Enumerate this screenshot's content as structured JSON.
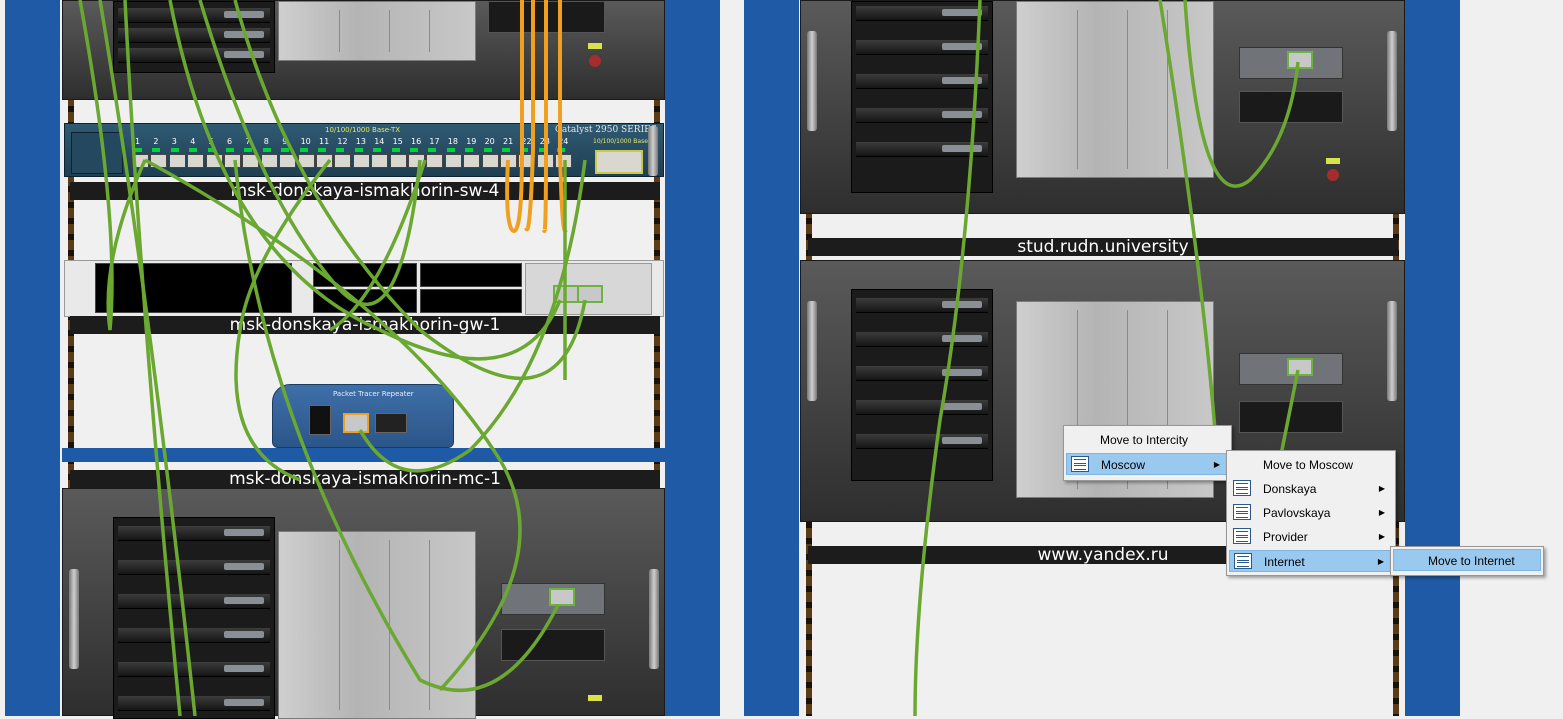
{
  "left_rack": {
    "devices": [
      {
        "label": "msk-donskaya-ismakhorin-sw-4"
      },
      {
        "label": "msk-donskaya-ismakhorin-gw-1"
      },
      {
        "label": "msk-donskaya-ismakhorin-mc-1"
      }
    ],
    "switch": {
      "header": "10/100/1000 Base-TX",
      "model": "Catalyst 2950 SERIES",
      "uplink_label": "10/100/1000 Base-T",
      "port_numbers": [
        "1",
        "2",
        "3",
        "4",
        "5",
        "6",
        "7",
        "8",
        "9",
        "10",
        "11",
        "12",
        "13",
        "14",
        "15",
        "16",
        "17",
        "18",
        "19",
        "20",
        "21",
        "22",
        "23",
        "24"
      ]
    },
    "repeater": {
      "label": "Packet Tracer Repeater"
    }
  },
  "right_rack": {
    "devices": [
      {
        "label": "stud.rudn.university"
      },
      {
        "label": "www.yandex.ru"
      }
    ]
  },
  "context_menu": {
    "main": [
      {
        "label": "Move to Intercity"
      },
      {
        "label": "Moscow",
        "icon": "building-icon"
      }
    ],
    "moscow_submenu": [
      {
        "label": "Move to Moscow"
      },
      {
        "label": "Donskaya",
        "icon": "rack-icon"
      },
      {
        "label": "Pavlovskaya",
        "icon": "rack-icon"
      },
      {
        "label": "Provider",
        "icon": "rack-icon"
      },
      {
        "label": "Internet",
        "icon": "rack-icon"
      }
    ],
    "internet_submenu": [
      {
        "label": "Move to Internet"
      }
    ]
  },
  "colors": {
    "rack_blue": "#1f5aa6",
    "cable_green": "#6aa832",
    "cable_orange": "#f0a020",
    "menu_highlight": "#99c9ef"
  }
}
